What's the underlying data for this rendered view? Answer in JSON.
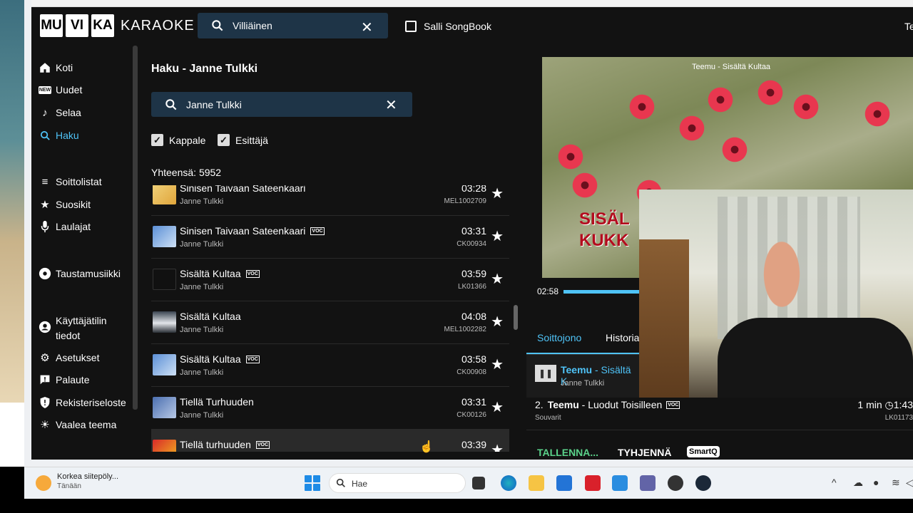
{
  "header": {
    "logo_parts": [
      "MU",
      "VI",
      "KA"
    ],
    "logo_word": "KARAOKE",
    "search_value": "Villiäinen",
    "songbook_label": "Salli SongBook",
    "user_label": "Te"
  },
  "sidebar": {
    "items": [
      {
        "label": "Koti",
        "icon": "home-icon"
      },
      {
        "label": "Uudet",
        "icon": "new-icon"
      },
      {
        "label": "Selaa",
        "icon": "music-note-icon"
      },
      {
        "label": "Haku",
        "icon": "search-icon",
        "active": true
      },
      {
        "label": "Soittolistat",
        "icon": "playlist-icon"
      },
      {
        "label": "Suosikit",
        "icon": "star-icon"
      },
      {
        "label": "Laulajat",
        "icon": "microphone-icon"
      },
      {
        "label": "Taustamusiikki",
        "icon": "disc-icon"
      },
      {
        "label": "Käyttäjätilin",
        "label2": "tiedot",
        "icon": "account-icon"
      },
      {
        "label": "Asetukset",
        "icon": "gear-icon"
      },
      {
        "label": "Palaute",
        "icon": "feedback-icon"
      },
      {
        "label": "Rekisteriseloste",
        "icon": "shield-icon"
      },
      {
        "label": "Vaalea teema",
        "icon": "sun-icon"
      }
    ]
  },
  "results": {
    "title": "Haku - Janne Tulkki",
    "search_value": "Janne Tulkki",
    "filters": [
      {
        "label": "Kappale",
        "checked": true
      },
      {
        "label": "Esittäjä",
        "checked": true
      }
    ],
    "total": "Yhteensä: 5952",
    "rows": [
      {
        "title": "Sinisen Taivaan Sateenkaari",
        "artist": "Janne Tulkki",
        "duration": "03:28",
        "code": "MEL1002709",
        "voc": false
      },
      {
        "title": "Sinisen Taivaan Sateenkaari",
        "artist": "Janne Tulkki",
        "duration": "03:31",
        "code": "CK00934",
        "voc": true
      },
      {
        "title": "Sisältä Kultaa",
        "artist": "Janne Tulkki",
        "duration": "03:59",
        "code": "LK01366",
        "voc": true
      },
      {
        "title": "Sisältä Kultaa",
        "artist": "Janne Tulkki",
        "duration": "04:08",
        "code": "MEL1002282",
        "voc": false
      },
      {
        "title": "Sisältä Kultaa",
        "artist": "Janne Tulkki",
        "duration": "03:58",
        "code": "CK00908",
        "voc": true
      },
      {
        "title": "Tiellä Turhuuden",
        "artist": "Janne Tulkki",
        "duration": "03:31",
        "code": "CK00126",
        "voc": false
      },
      {
        "title": "Tiellä turhuuden",
        "artist": "",
        "duration": "03:39",
        "code": "",
        "voc": true
      }
    ],
    "voc_label": "VOC"
  },
  "player": {
    "video_title": "Teemu - Sisältä Kultaa",
    "lyric_line1": "SISÄL",
    "lyric_line2": "KUKK",
    "time_current": "02:58",
    "progress": 0.2
  },
  "queue": {
    "tabs": [
      "Soittojono",
      "Historia"
    ],
    "current": {
      "singer": "Teemu",
      "song": " - Sisältä K",
      "artist": "Janne Tulkki"
    },
    "next": {
      "number": "2.",
      "singer": "Teemu",
      "song": " - Luodut Toisilleen",
      "artist": "Souvarit",
      "wait": "1 min",
      "time": "1:43",
      "code": "LK01173"
    },
    "actions": {
      "save": "TALLENNA...",
      "clear": "TYHJENNÄ",
      "smart": "SmartQ"
    }
  },
  "taskbar": {
    "weather_title": "Korkea siitepöly...",
    "weather_sub": "Tänään",
    "search_placeholder": "Hae"
  },
  "colors": {
    "accent": "#4fc3f7",
    "save_green": "#5ad28a",
    "search_bg": "#1e3447",
    "app_bg": "#121212"
  }
}
